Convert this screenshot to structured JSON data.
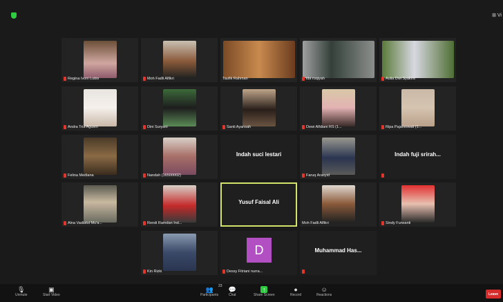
{
  "topbar": {
    "view_label": "⊞ Vi"
  },
  "participants": [
    {
      "name": "Regina Ivoni Lubis"
    },
    {
      "name": "Moh Fadli Alfikri"
    },
    {
      "name": "Taufik Rahman"
    },
    {
      "name": "ida roqiyah"
    },
    {
      "name": "Aulia Dwi Syakira"
    },
    {
      "name": "Andra Tria Agustri"
    },
    {
      "name": "Dini Suryani"
    },
    {
      "name": "Santi Ayansah"
    },
    {
      "name": "Dewi Alfdiani RS (1..."
    },
    {
      "name": "Ripa Pajarsowati (1..."
    },
    {
      "name": "Felina Mediana"
    },
    {
      "name": "Nandah (16500002)"
    },
    {
      "name": "Indah suci lestari"
    },
    {
      "name": "Faruq Arasyid"
    },
    {
      "name": "Indah fuji srirah..."
    },
    {
      "name": "Alna Vadiatul Mu'a..."
    },
    {
      "name": "Rendi Ramdan Ind..."
    },
    {
      "name": "Yusuf Faisal Ali"
    },
    {
      "name": "Moh Fadli Alfikri"
    },
    {
      "name": "Sindy Furwanti"
    },
    {
      "name": "Kin Rizki"
    },
    {
      "name": "Dessy Fitriani nurra..."
    },
    {
      "name": "Muhammad Has..."
    }
  ],
  "avatar_letter": "D",
  "toolbar": {
    "unmute": "Unmute",
    "start_video": "Start Video",
    "participants": "Participants",
    "participants_count": "23",
    "chat": "Chat",
    "share": "Share Screen",
    "record": "Record",
    "reactions": "Reactions",
    "leave": "Leave"
  },
  "colors": {
    "active_border": "#d4e36a",
    "leave": "#d62b2b",
    "avatar": "#b14fc3",
    "shield": "#2ecc40"
  }
}
